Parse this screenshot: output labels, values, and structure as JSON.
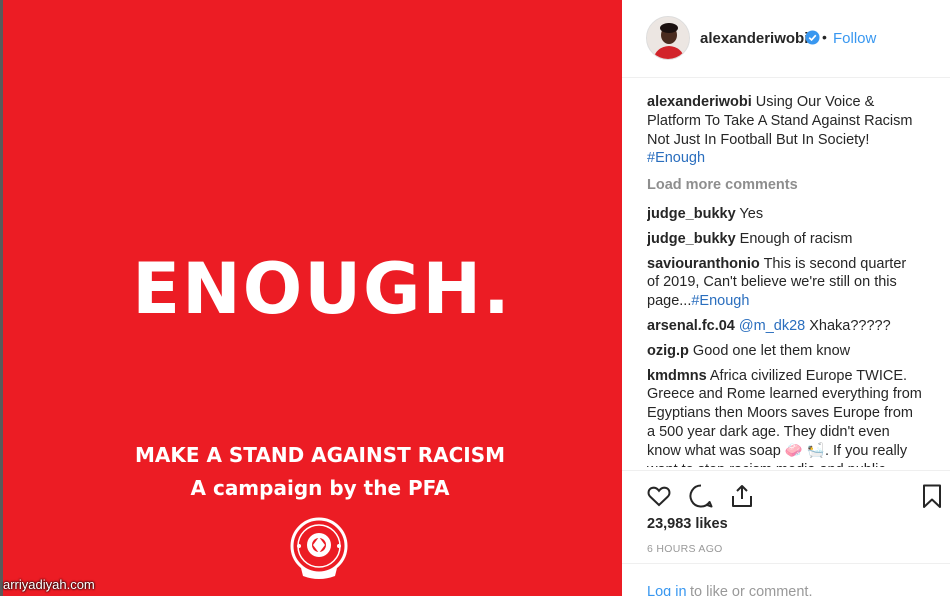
{
  "post_image": {
    "headline": "ENOUGH.",
    "line1": "MAKE A STAND AGAINST RACISM",
    "line2": "A campaign by the PFA",
    "watermark": "arriyadiyah.com",
    "background_color": "#ec1c24"
  },
  "header": {
    "username": "alexanderiwobi",
    "dot": "•",
    "follow_label": "Follow",
    "verified_icon": "verified-badge-icon"
  },
  "caption": {
    "username": "alexanderiwobi",
    "text": "Using Our Voice & Platform To Take A Stand Against Racism Not Just In Football But In Society!",
    "hashtag": "#Enough"
  },
  "load_more_label": "Load more comments",
  "comments": [
    {
      "user": "judge_bukky",
      "text": "Yes"
    },
    {
      "user": "judge_bukky",
      "text": "Enough of racism"
    },
    {
      "user": "saviouranthonio",
      "text": "This is second quarter of 2019, Can't believe we're still on this page...",
      "tag": "#Enough"
    },
    {
      "user": "arsenal.fc.04",
      "mention": "@m_dk28",
      "text": "Xhaka?????"
    },
    {
      "user": "ozig.p",
      "text": "Good one let them know"
    },
    {
      "user": "kmdmns",
      "text": "Africa civilized Europe TWICE. Greece and Rome learned everything from Egyptians then Moors saves Europe from a 500 year dark age. They didn't even know what was soap 🧼 🛀. If you really want to stop racism media and public figures need"
    }
  ],
  "actions": {
    "icons": [
      "heart-icon",
      "comment-icon",
      "share-icon",
      "bookmark-icon"
    ]
  },
  "likes": "23,983 likes",
  "timestamp": "6 HOURS AGO",
  "login": {
    "link": "Log in",
    "rest": "to like or comment."
  },
  "colors": {
    "link_blue": "#3897f0",
    "hashtag_blue": "#2a6ebe",
    "muted": "#8e8e8e"
  }
}
